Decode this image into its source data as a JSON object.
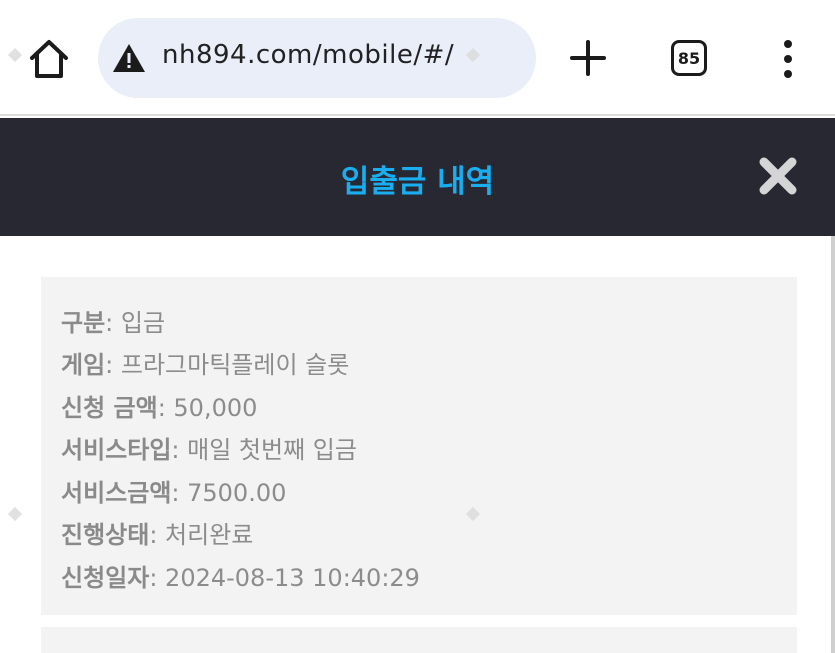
{
  "browser": {
    "url": "nh894.com/mobile/#/",
    "tab_count": "85"
  },
  "modal": {
    "title": "입출금 내역"
  },
  "transaction": {
    "rows": [
      {
        "label": "구분",
        "value": "입금"
      },
      {
        "label": "게임",
        "value": "프라그마틱플레이 슬롯"
      },
      {
        "label": "신청 금액",
        "value": "50,000"
      },
      {
        "label": "서비스타입",
        "value": "매일 첫번째 입금"
      },
      {
        "label": "서비스금액",
        "value": "7500.00"
      },
      {
        "label": "진행상태",
        "value": "처리완료"
      },
      {
        "label": "신청일자",
        "value": "2024-08-13 10:40:29"
      }
    ]
  },
  "colors": {
    "header_bg": "#272832",
    "title": "#19aef0",
    "card_bg": "#f3f3f3",
    "url_pill": "#e9eef8"
  },
  "icons": {
    "home": "home-icon",
    "warning": "warning-triangle-icon",
    "new_tab": "plus-icon",
    "menu": "more-vertical-icon",
    "close": "close-icon"
  }
}
